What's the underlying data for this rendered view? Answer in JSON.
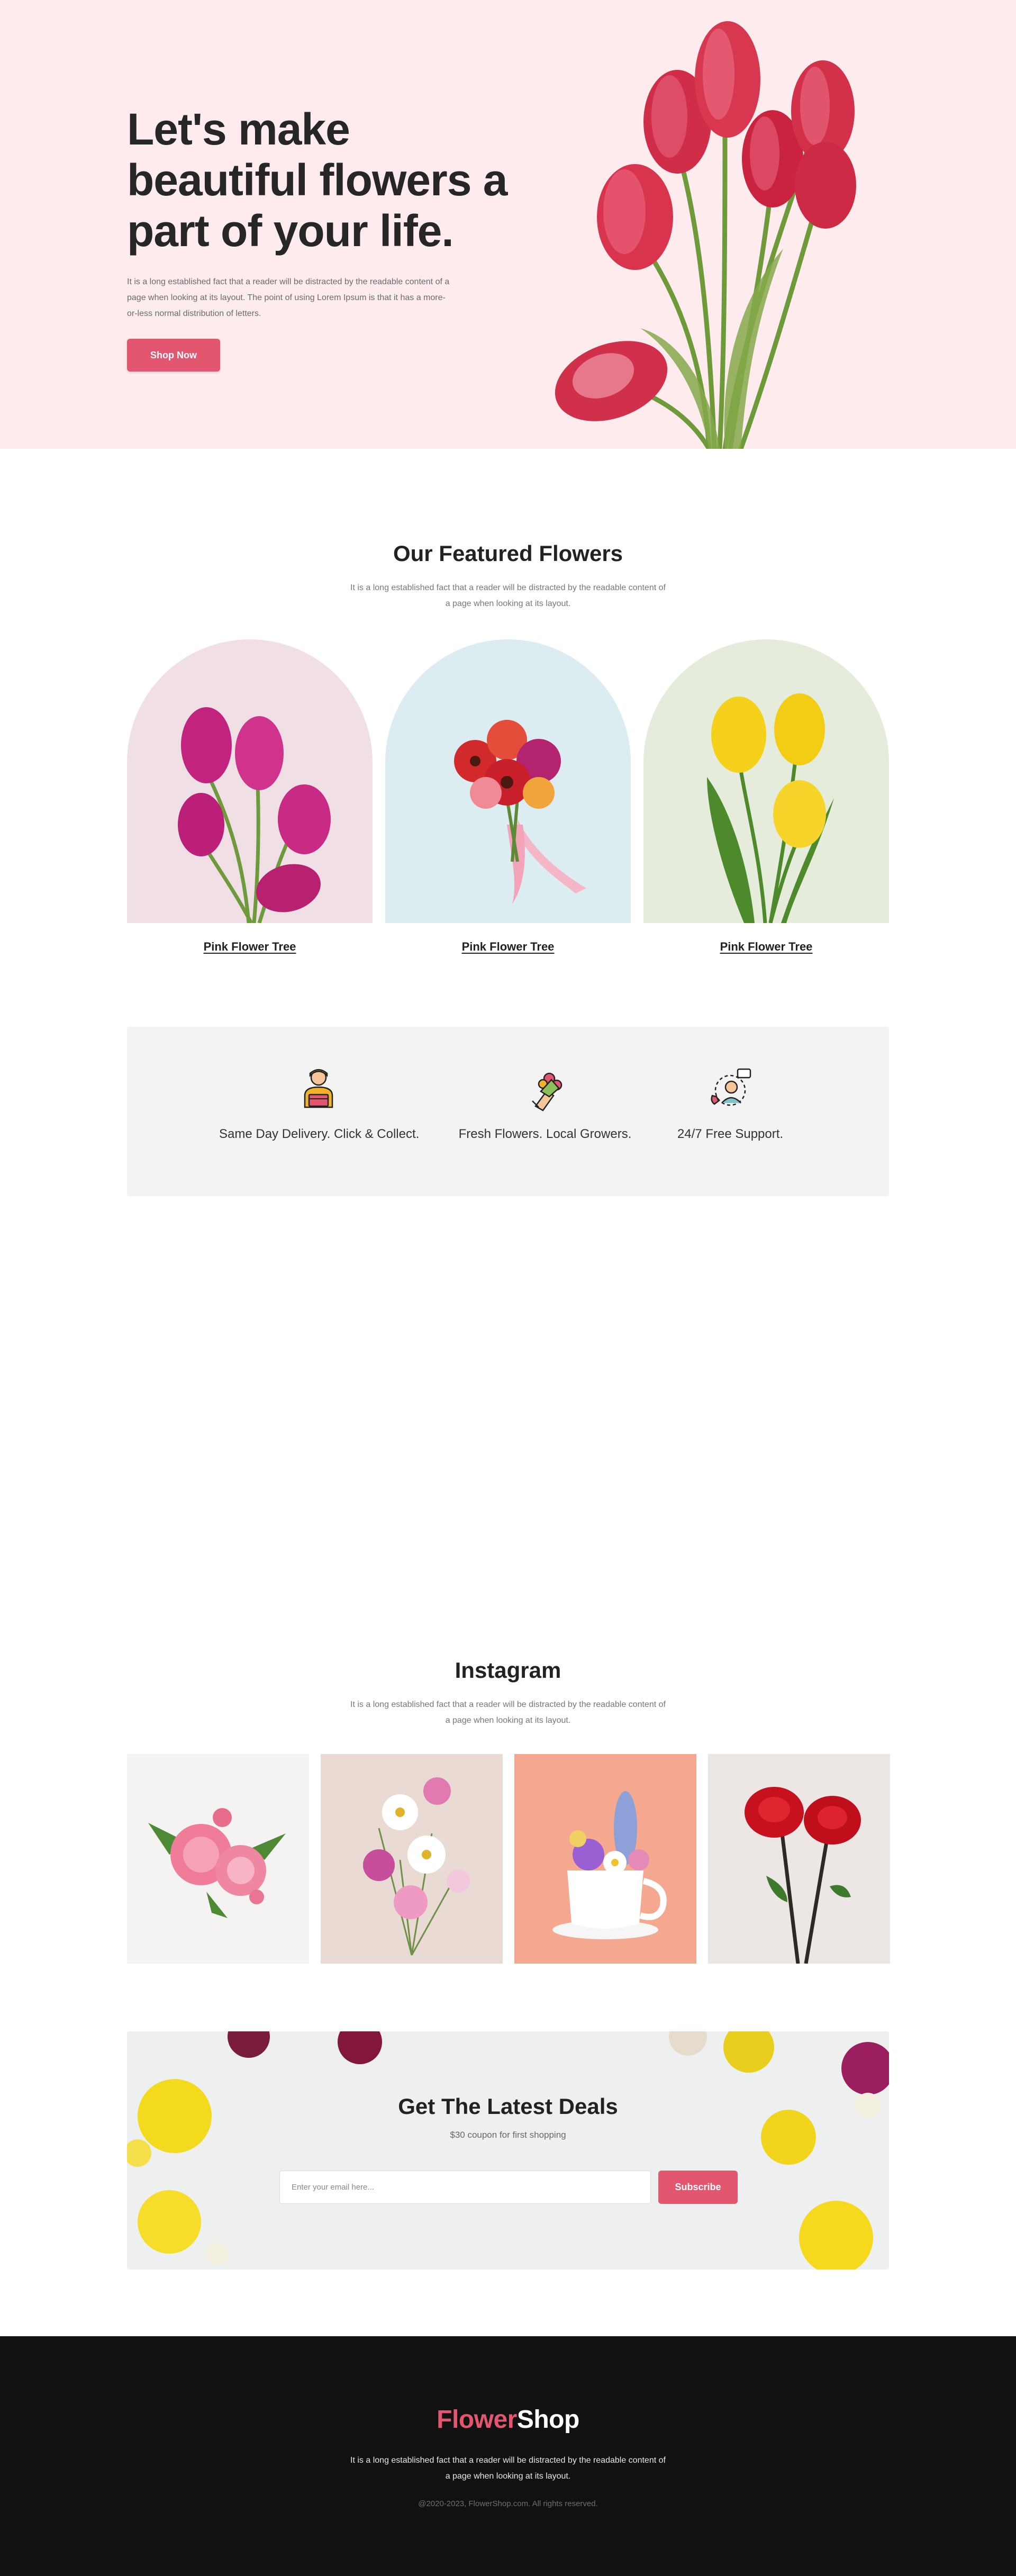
{
  "hero": {
    "title": "Let's make beautiful flowers a part of your life.",
    "text": "It is a long established fact that a reader will be distracted by the readable content of a page when looking at its layout. The point of using Lorem Ipsum is that it has a more-or-less normal distribution of letters.",
    "button": "Shop Now"
  },
  "featured": {
    "title": "Our Featured Flowers",
    "subtitle": "It is a long established fact that a reader will be distracted by the readable content of a page when looking at its layout.",
    "items": [
      {
        "label": "Pink Flower Tree",
        "bg": "#f1dfe6"
      },
      {
        "label": "Pink Flower Tree",
        "bg": "#dcedf1"
      },
      {
        "label": "Pink Flower Tree",
        "bg": "#e6ecdb"
      }
    ]
  },
  "features": [
    {
      "icon": "delivery-person-icon",
      "text": "Same Day Delivery. Click & Collect."
    },
    {
      "icon": "bouquet-hand-icon",
      "text": "Fresh Flowers. Local Growers."
    },
    {
      "icon": "support-agent-icon",
      "text": "24/7 Free Support."
    }
  ],
  "instagram": {
    "title": "Instagram",
    "subtitle": "It is a long established fact that a reader will be distracted by the readable content of a page when looking at its layout."
  },
  "deals": {
    "title": "Get The Latest Deals",
    "subtitle": "$30 coupon for first shopping",
    "input_placeholder": "Enter your email here...",
    "button": "Subscribe"
  },
  "footer": {
    "logo_part1": "Flower",
    "logo_part2": "Shop",
    "text": "It is a long established fact that a reader will be distracted by the readable content of a page when looking at its layout.",
    "copyright": "@2020-2023, FlowerShop.com. All rights reserved."
  },
  "colors": {
    "accent": "#e2566f",
    "hero_bg": "#fdebee",
    "footer_bg": "#121112"
  }
}
